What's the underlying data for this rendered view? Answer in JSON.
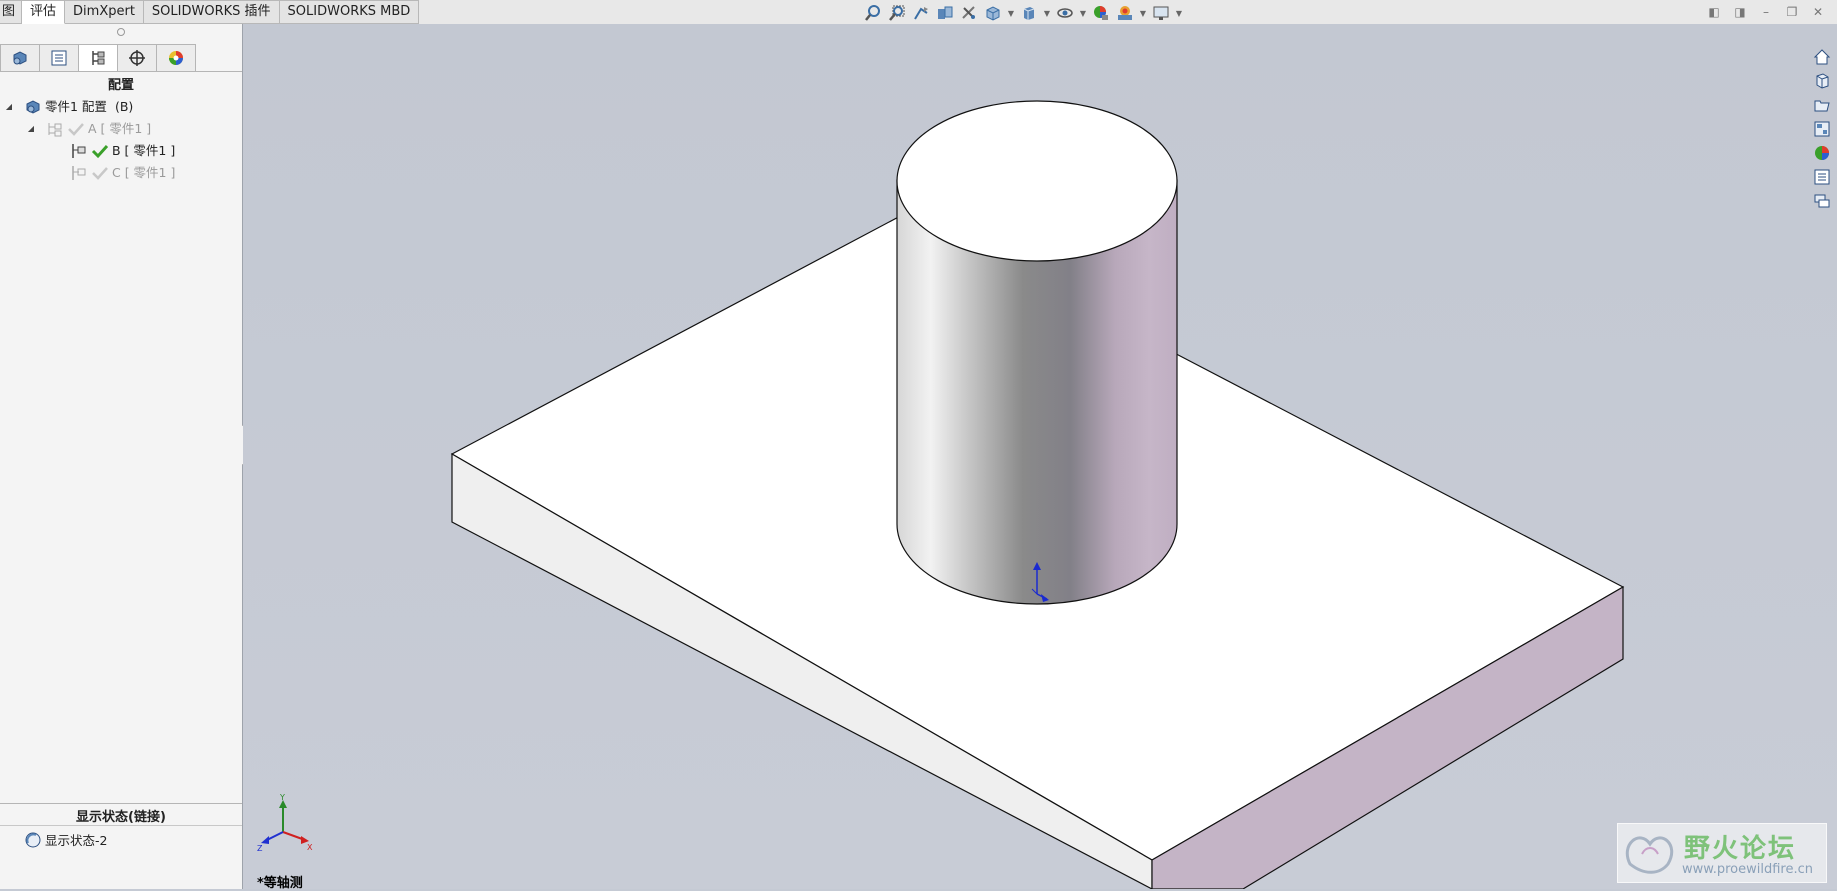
{
  "tabs": [
    {
      "label": "图",
      "active": false
    },
    {
      "label": "评估",
      "active": true
    },
    {
      "label": "DimXpert",
      "active": false
    },
    {
      "label": "SOLIDWORKS 插件",
      "active": false
    },
    {
      "label": "SOLIDWORKS MBD",
      "active": false
    }
  ],
  "toolbar_icons": [
    "zoom-to-fit-icon",
    "zoom-area-icon",
    "previous-view-icon",
    "section-view-icon",
    "view-orientation-icon",
    "display-style-icon",
    "hide-show-icon",
    "edit-appearance-icon",
    "apply-scene-icon",
    "view-settings-icon"
  ],
  "panel": {
    "tabs": [
      "feature-manager-icon",
      "property-manager-icon",
      "configuration-manager-icon",
      "dimxpert-manager-icon",
      "display-manager-icon"
    ],
    "title": "配置",
    "root": {
      "label": "零件1 配置",
      "suffix": "(B)"
    },
    "configs": [
      {
        "label": "A [ 零件1 ]",
        "active": false,
        "level": 1
      },
      {
        "label": "B [ 零件1 ]",
        "active": true,
        "level": 2
      },
      {
        "label": "C [ 零件1 ]",
        "active": false,
        "level": 2
      }
    ],
    "display_states_title": "显示状态(链接)",
    "display_state": "显示状态-2"
  },
  "viewport": {
    "view_label": "*等轴测",
    "triad": {
      "x": "X",
      "y": "Y",
      "z": "Z"
    },
    "watermark": {
      "title": "野火论坛",
      "url": "www.proewildfire.cn"
    }
  },
  "colors": {
    "viewport_bg": "#c5cad4",
    "face_white": "#ffffff",
    "face_side_left": "#efefef",
    "face_side_right": "#c4b4c6",
    "check_green": "#3aa02a"
  }
}
